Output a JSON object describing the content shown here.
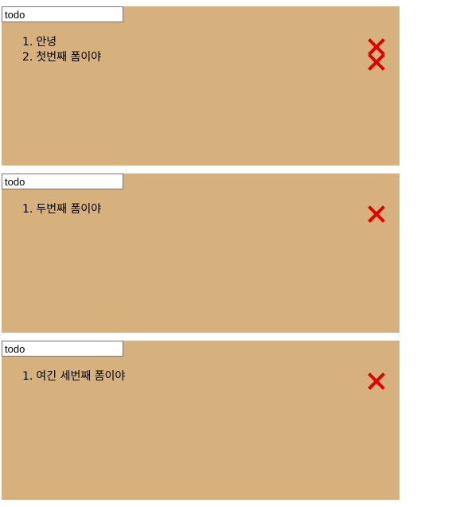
{
  "forms": [
    {
      "input": {
        "placeholder": "todo",
        "value": ""
      },
      "items": [
        {
          "num": "1.",
          "text": "안녕"
        },
        {
          "num": "2.",
          "text": "첫번째 폼이야"
        }
      ]
    },
    {
      "input": {
        "placeholder": "todo",
        "value": ""
      },
      "items": [
        {
          "num": "1.",
          "text": "두번째 폼이야"
        }
      ]
    },
    {
      "input": {
        "placeholder": "todo",
        "value": ""
      },
      "items": [
        {
          "num": "1.",
          "text": "여긴 세번째 폼이야"
        }
      ]
    }
  ],
  "colors": {
    "panel": "#d6b07d",
    "delete_icon": "#e00000"
  }
}
